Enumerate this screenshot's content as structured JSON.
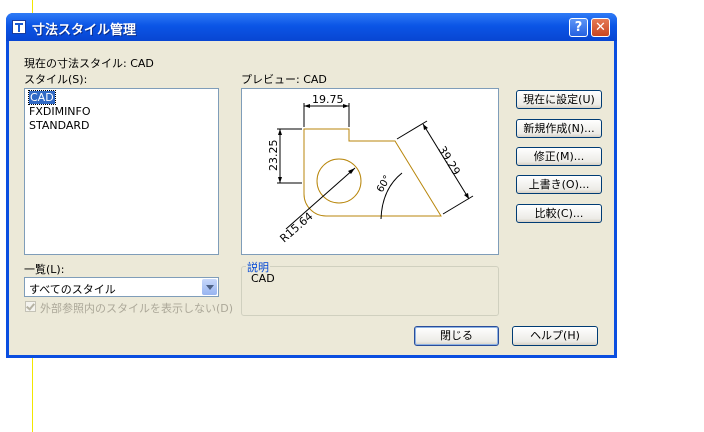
{
  "dialog": {
    "title": "寸法スタイル管理",
    "help_glyph": "?",
    "close_glyph": "✕"
  },
  "current_style_label": "現在の寸法スタイル: CAD",
  "styles_label": "スタイル(S):",
  "styles": [
    {
      "name": "CAD",
      "selected": true
    },
    {
      "name": "FXDIMINFO",
      "selected": false
    },
    {
      "name": "STANDARD",
      "selected": false
    }
  ],
  "preview_label": "プレビュー: CAD",
  "preview": {
    "dim_top": "19.75",
    "dim_left": "23.25",
    "dim_right": "39.29",
    "angle": "60°",
    "radius": "R15.64"
  },
  "list_label": "一覧(L):",
  "list_select_value": "すべてのスタイル",
  "xref_checkbox_label": "外部参照内のスタイルを表示しない(D)",
  "xref_checkbox_checked": true,
  "description_title": "説明",
  "description_text": "CAD",
  "buttons": {
    "set_current": "現在に設定(U)",
    "new": "新規作成(N)...",
    "modify": "修正(M)...",
    "override": "上書き(O)...",
    "compare": "比較(C)...",
    "close": "閉じる",
    "help": "ヘルプ(H)"
  },
  "colors": {
    "titlebar": "#0b55e6",
    "selection": "#316ac5",
    "preview_geometry": "#b8860b"
  }
}
